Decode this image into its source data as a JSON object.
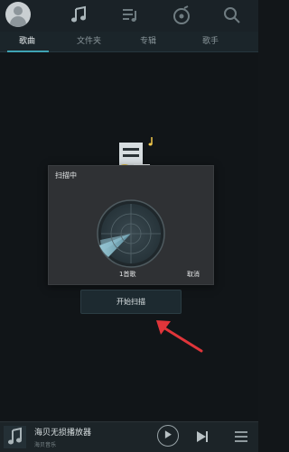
{
  "tabs": [
    {
      "label": "歌曲"
    },
    {
      "label": "文件夹"
    },
    {
      "label": "专辑"
    },
    {
      "label": "歌手"
    }
  ],
  "dialog": {
    "title": "扫描中",
    "count": "1首歌",
    "cancel": "取消"
  },
  "scan_button": "开始扫描",
  "player": {
    "title": "海贝无损播放器",
    "artist": "海贝音乐"
  },
  "colors": {
    "accent": "#3fa3b3",
    "arrow": "#e0353a",
    "music_note": "#f0c64a"
  },
  "icons": {
    "avatar": "user-avatar-icon",
    "music": "music-note-icon",
    "playlist": "playlist-icon",
    "disc": "disc-icon",
    "search": "search-icon"
  }
}
